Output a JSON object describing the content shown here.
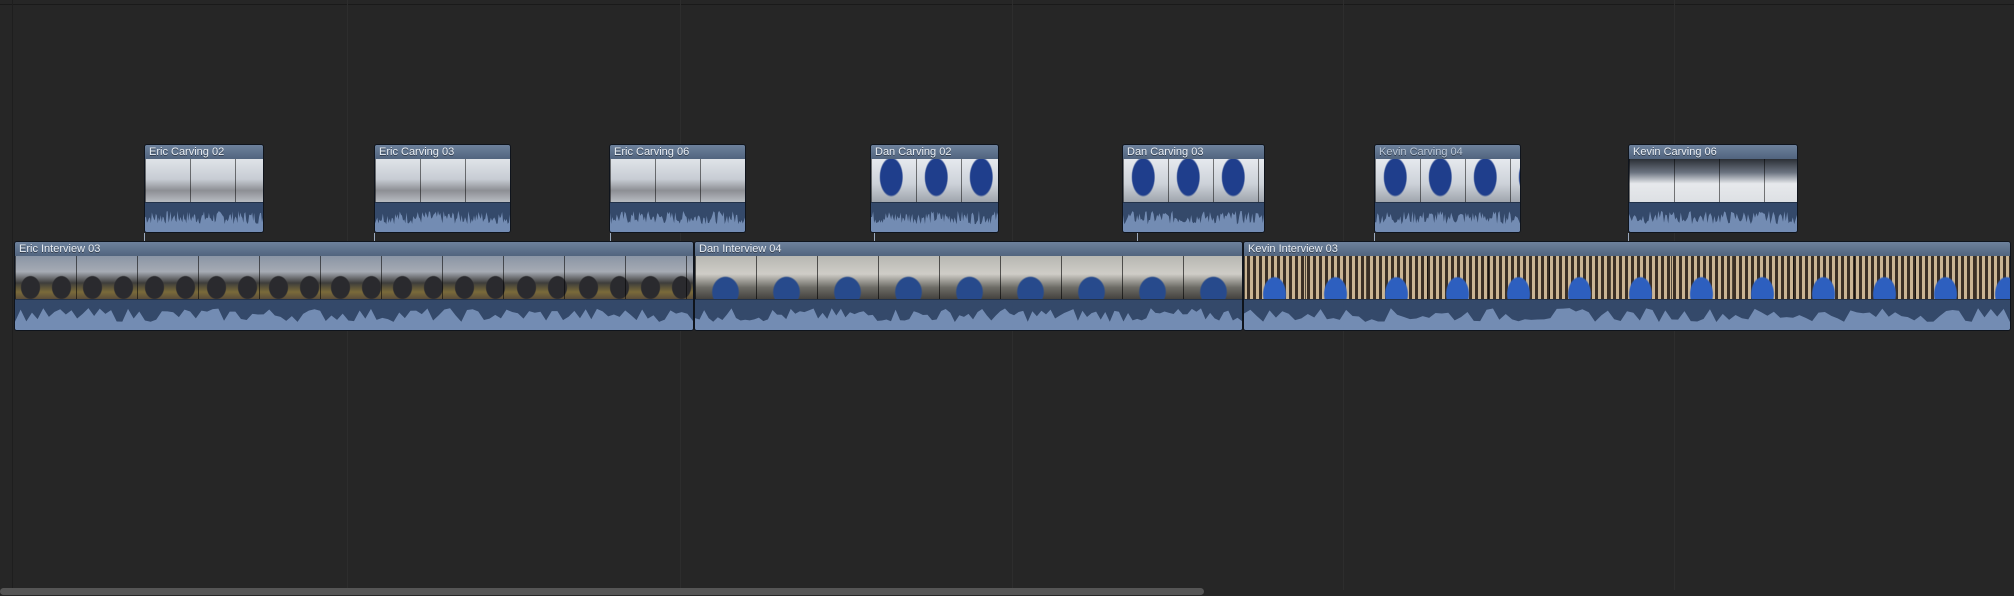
{
  "timeline": {
    "connected_clips": [
      {
        "label": "Eric Carving 02",
        "theme": "fs-snow"
      },
      {
        "label": "Eric Carving 03",
        "theme": "fs-snow"
      },
      {
        "label": "Eric Carving 06",
        "theme": "fs-snow"
      },
      {
        "label": "Dan Carving 02",
        "theme": "fs-snowblue"
      },
      {
        "label": "Dan Carving 03",
        "theme": "fs-snowblue"
      },
      {
        "label": "Kevin Carving 04",
        "theme": "fs-snowblue"
      },
      {
        "label": "Kevin Carving 06",
        "theme": "fs-dark"
      }
    ],
    "primary_clips": [
      {
        "label": "Eric Interview 03",
        "theme": "fs-eric"
      },
      {
        "label": "Dan Interview 04",
        "theme": "fs-dan"
      },
      {
        "label": "Kevin Interview 03",
        "theme": "fs-kevin"
      }
    ]
  },
  "colors": {
    "background": "#262626",
    "clip_body": "#3b5578",
    "clip_header": "#5d7190",
    "waveform": "#7f98bf"
  }
}
